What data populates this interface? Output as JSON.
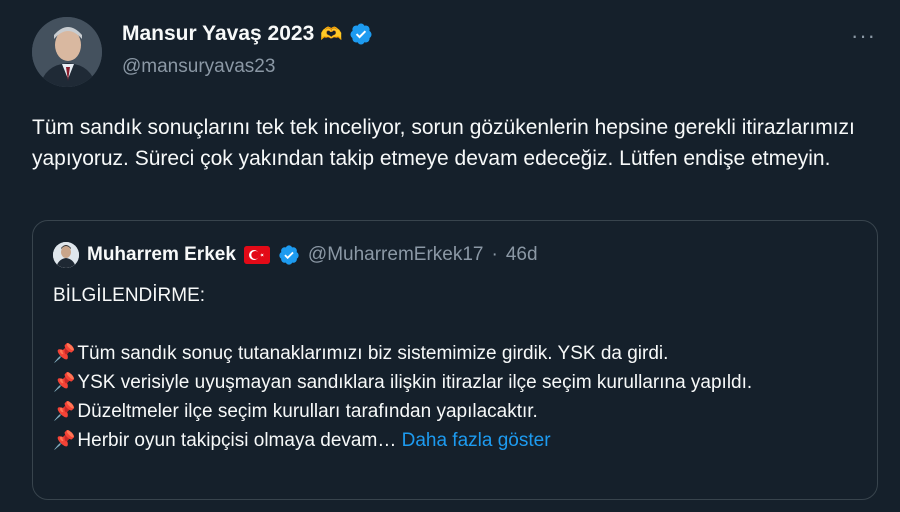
{
  "tweet": {
    "author_name": "Mansur Yavaş 2023",
    "author_emoji": "🫶",
    "handle": "@mansuryavas23",
    "text": "Tüm sandık sonuçlarını tek tek inceliyor, sorun gözükenlerin hepsine gerekli itirazlarımızı yapıyoruz. Süreci çok yakından takip etmeye devam edeceğiz. Lütfen endişe etmeyin."
  },
  "quoted": {
    "author_name": "Muharrem Erkek",
    "handle": "@MuharremErkek17",
    "separator": "·",
    "time": "46d",
    "title": "BİLGİLENDİRME:",
    "lines": [
      "Tüm sandık sonuç tutanaklarımızı biz sistemimize girdik. YSK da girdi.",
      "YSK verisiyle uyuşmayan sandıklara ilişkin itirazlar ilçe seçim kurullarına yapıldı.",
      "Düzeltmeler ilçe seçim kurulları tarafından yapılacaktır.",
      "Herbir oyun takipçisi olmaya devam…"
    ],
    "show_more": "Daha fazla göster"
  },
  "icons": {
    "verified": "verified-badge-icon",
    "more": "more-options-icon",
    "pin": "pushpin-icon",
    "flag": "turkey-flag-icon"
  },
  "colors": {
    "background": "#15202b",
    "accent": "#1d9bf0",
    "muted": "#8b98a5"
  }
}
